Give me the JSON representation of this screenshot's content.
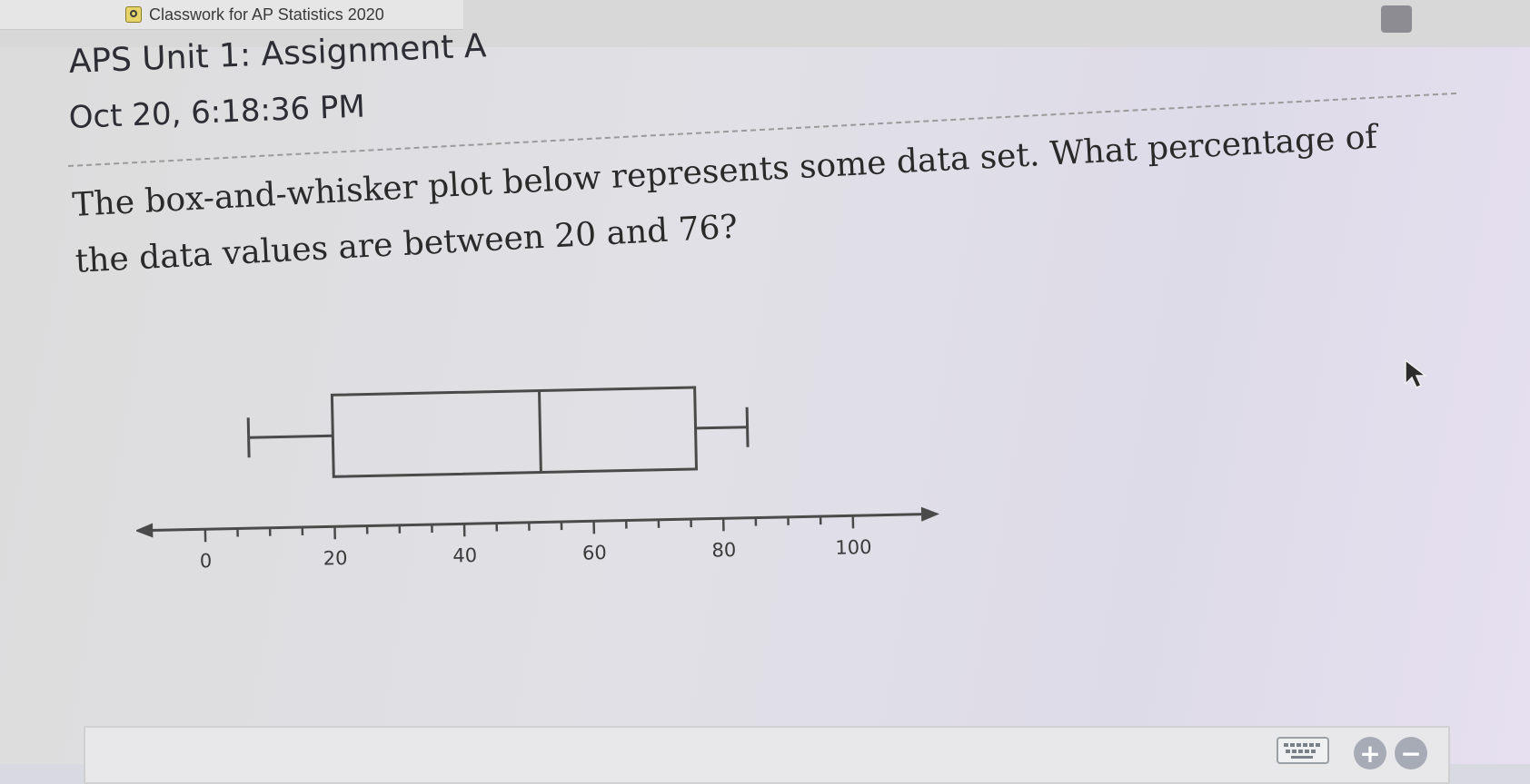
{
  "browser": {
    "tab_title": "Classwork for AP Statistics 2020"
  },
  "assignment": {
    "title": "APS Unit 1: Assignment A",
    "timestamp": "Oct 20, 6:18:36 PM"
  },
  "question": {
    "text": "The box-and-whisker plot below represents some data set. What percentage of the data values are between 20 and 76?"
  },
  "chart_data": {
    "type": "boxplot",
    "min": 7,
    "q1": 20,
    "median": 52,
    "q3": 76,
    "max": 84,
    "axis": {
      "xlim": [
        -5,
        110
      ],
      "major_ticks": [
        0,
        20,
        40,
        60,
        80,
        100
      ],
      "tick_labels": [
        "0",
        "20",
        "40",
        "60",
        "80",
        "100"
      ],
      "minor_step": 5
    }
  },
  "controls": {
    "plus_symbol": "+",
    "minus_symbol": "−"
  },
  "icons": {
    "tab": "classroom-icon",
    "window": "window-control-icon",
    "cursor": "mouse-pointer-icon",
    "keyboard": "keyboard-icon"
  }
}
